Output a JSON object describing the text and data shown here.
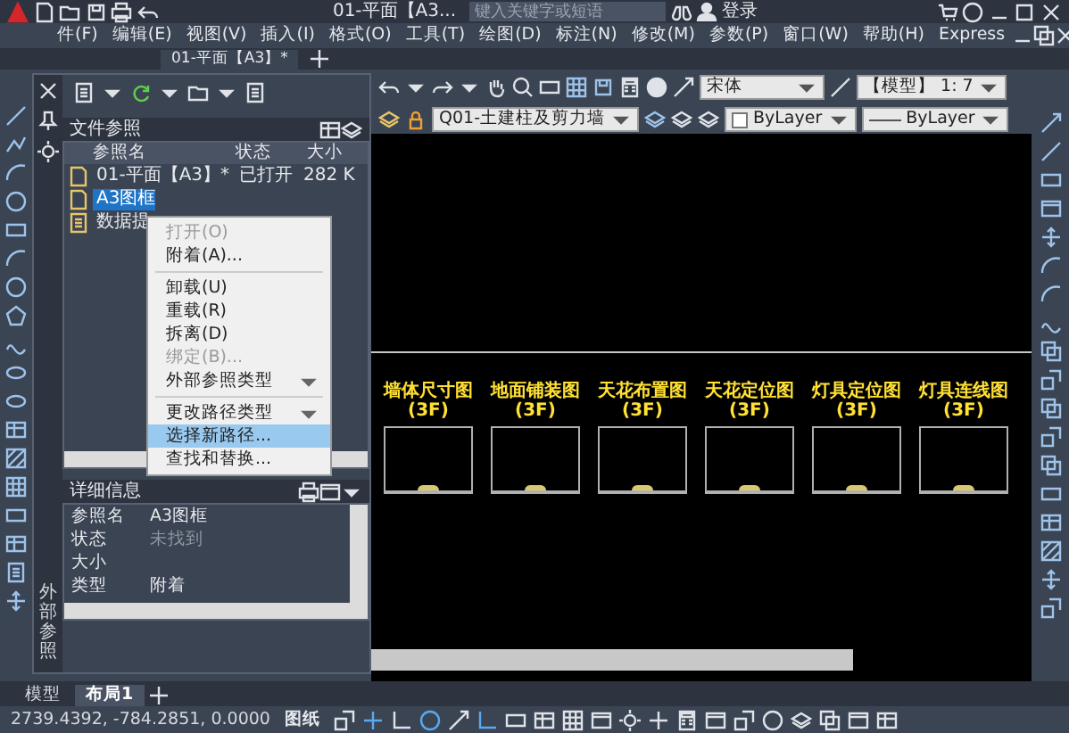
{
  "title_bar": {
    "title": "01-平面【A3...",
    "search_placeholder": "键入关键字或短语",
    "user": "登录"
  },
  "menu_bar": [
    "件(F)",
    "编辑(E)",
    "视图(V)",
    "插入(I)",
    "格式(O)",
    "工具(T)",
    "绘图(D)",
    "标注(N)",
    "修改(M)",
    "参数(P)",
    "窗口(W)",
    "帮助(H)",
    "Express"
  ],
  "document_tabs": [
    {
      "label": "01-平面【A3】*",
      "selected": true
    }
  ],
  "toolbar": {
    "font": "宋体",
    "scale": "【模型】 1: 7",
    "layer": "Q01-土建柱及剪力墙",
    "color_setting": "ByLayer",
    "linetype": "ByLayer"
  },
  "palette": {
    "side_label": "外部参照",
    "title": "文件参照",
    "columns": [
      "参照名",
      "状态",
      "大小"
    ],
    "rows": [
      {
        "name": "01-平面【A3】*",
        "status": "已打开",
        "size": "282 K",
        "selected": false
      },
      {
        "name": "A3图框",
        "selected": true
      },
      {
        "name": "数据提",
        "selected": false
      }
    ],
    "context_menu": [
      {
        "kind": "item",
        "label": "打开(O)",
        "disabled": true,
        "submenu": false,
        "selected": false
      },
      {
        "kind": "item",
        "label": "附着(A)...",
        "disabled": false,
        "submenu": false,
        "selected": false
      },
      {
        "kind": "separator"
      },
      {
        "kind": "item",
        "label": "卸载(U)",
        "disabled": false,
        "submenu": false,
        "selected": false
      },
      {
        "kind": "item",
        "label": "重载(R)",
        "disabled": false,
        "submenu": false,
        "selected": false
      },
      {
        "kind": "item",
        "label": "拆离(D)",
        "disabled": false,
        "submenu": false,
        "selected": false
      },
      {
        "kind": "item",
        "label": "绑定(B)...",
        "disabled": true,
        "submenu": false,
        "selected": false
      },
      {
        "kind": "item",
        "label": "外部参照类型",
        "disabled": false,
        "submenu": true,
        "selected": false
      },
      {
        "kind": "separator"
      },
      {
        "kind": "item",
        "label": "更改路径类型",
        "disabled": false,
        "submenu": true,
        "selected": false
      },
      {
        "kind": "item",
        "label": "选择新路径...",
        "disabled": false,
        "submenu": false,
        "selected": true
      },
      {
        "kind": "item",
        "label": "查找和替换...",
        "disabled": false,
        "submenu": false,
        "selected": false
      }
    ],
    "details": {
      "title": "详细信息",
      "rows": [
        {
          "label": "参照名",
          "value": "A3图框",
          "dim": false
        },
        {
          "label": "状态",
          "value": "未找到",
          "dim": true
        },
        {
          "label": "大小"
        },
        {
          "label": "类型",
          "value": "附着",
          "dim": false
        }
      ]
    }
  },
  "drawing": {
    "frames": [
      {
        "title": "墙体尺寸图(3F)"
      },
      {
        "title": "地面铺装图(3F)"
      },
      {
        "title": "天花布置图(3F)"
      },
      {
        "title": "天花定位图(3F)"
      },
      {
        "title": "灯具定位图(3F)"
      },
      {
        "title": "灯具连线图(3F)"
      }
    ]
  },
  "layout_tabs": [
    {
      "label": "模型",
      "selected": false
    },
    {
      "label": "布局1",
      "selected": true
    }
  ],
  "status_bar": {
    "coordinates": "2739.4392, -784.2851, 0.0000",
    "mode": "图纸"
  }
}
